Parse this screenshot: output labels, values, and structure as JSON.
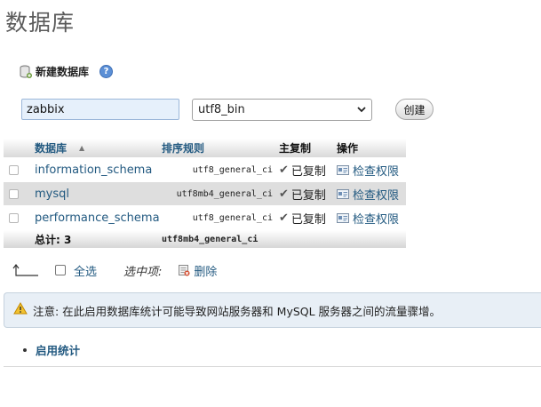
{
  "page": {
    "title": "数据库"
  },
  "create_db": {
    "heading": "新建数据库",
    "name_value": "zabbix",
    "collation_selected": "utf8_bin",
    "create_label": "创建"
  },
  "table": {
    "headers": {
      "name": "数据库",
      "collation": "排序规则",
      "replication": "主复制",
      "action": "操作"
    },
    "rows": [
      {
        "name": "information_schema",
        "collation": "utf8_general_ci",
        "replication": "已复制",
        "action": "检查权限"
      },
      {
        "name": "mysql",
        "collation": "utf8mb4_general_ci",
        "replication": "已复制",
        "action": "检查权限"
      },
      {
        "name": "performance_schema",
        "collation": "utf8_general_ci",
        "replication": "已复制",
        "action": "检查权限"
      }
    ],
    "footer": {
      "total": "总计: 3",
      "collation": "utf8mb4_general_ci"
    }
  },
  "bulk": {
    "check_all": "全选",
    "with_selected": "选中项:",
    "drop": "删除"
  },
  "notice": {
    "text": "注意: 在此启用数据库统计可能导致网站服务器和 MySQL 服务器之间的流量骤增。"
  },
  "stats_link": "启用统计",
  "colors": {
    "link": "#235a81",
    "notice_bg": "#e8eff6",
    "warning": "#e8a400"
  }
}
